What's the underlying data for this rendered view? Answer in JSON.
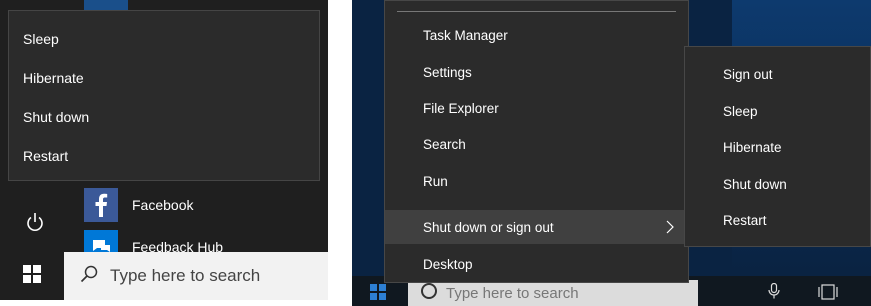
{
  "left": {
    "power_menu": {
      "items": [
        {
          "label": "Sleep"
        },
        {
          "label": "Hibernate"
        },
        {
          "label": "Shut down"
        },
        {
          "label": "Restart"
        }
      ]
    },
    "apps": [
      {
        "label": "Facebook",
        "icon": "facebook-icon"
      },
      {
        "label": "Feedback Hub",
        "icon": "feedback-hub-icon"
      }
    ],
    "taskbar": {
      "search_placeholder": "Type here to search"
    }
  },
  "right": {
    "winx_menu": {
      "items": [
        {
          "label": "Task Manager"
        },
        {
          "label": "Settings"
        },
        {
          "label": "File Explorer"
        },
        {
          "label": "Search"
        },
        {
          "label": "Run"
        },
        {
          "label": "Shut down or sign out",
          "has_submenu": true,
          "highlighted": true
        },
        {
          "label": "Desktop"
        }
      ]
    },
    "submenu": {
      "items": [
        {
          "label": "Sign out"
        },
        {
          "label": "Sleep"
        },
        {
          "label": "Hibernate"
        },
        {
          "label": "Shut down"
        },
        {
          "label": "Restart"
        }
      ]
    },
    "taskbar": {
      "search_placeholder": "Type here to search"
    }
  },
  "colors": {
    "menu_bg": "#2b2b2b",
    "highlight_bg": "#404040",
    "facebook_blue": "#3b5998",
    "tile_blue": "#0078d7",
    "wallpaper": "#0a2342"
  }
}
